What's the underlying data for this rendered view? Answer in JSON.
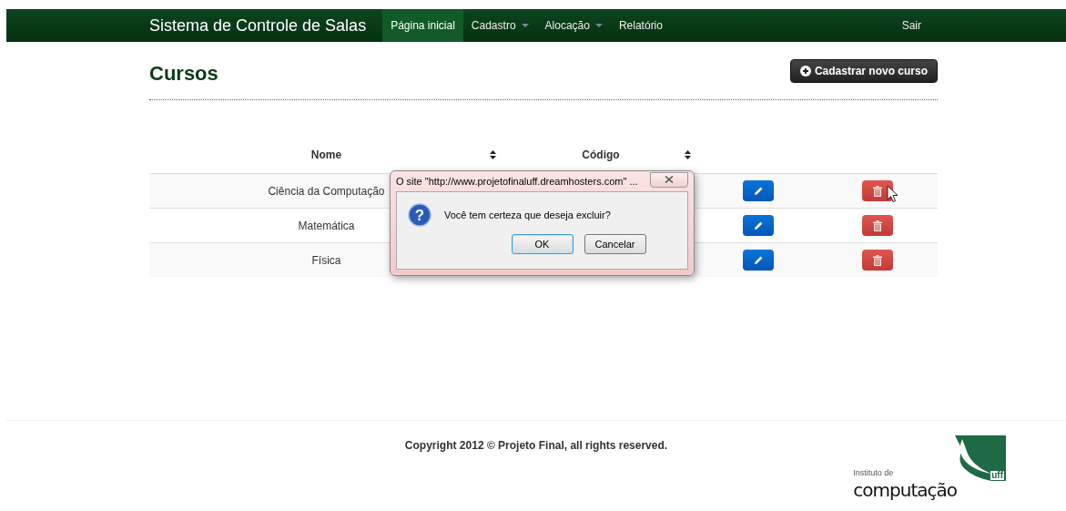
{
  "navbar": {
    "brand": "Sistema de Controle de Salas",
    "items": [
      {
        "label": "Página inicial",
        "selected": true,
        "dropdown": false
      },
      {
        "label": "Cadastro",
        "selected": false,
        "dropdown": true
      },
      {
        "label": "Alocação",
        "selected": false,
        "dropdown": true
      },
      {
        "label": "Relatório",
        "selected": false,
        "dropdown": false
      }
    ],
    "logout": "Sair"
  },
  "page": {
    "title": "Cursos",
    "add_button": "Cadastrar novo curso"
  },
  "table": {
    "columns": [
      {
        "label": "Nome",
        "sortable": true
      },
      {
        "label": "Código",
        "sortable": true
      }
    ],
    "rows": [
      {
        "name": "Ciência da Computação",
        "hovered": true
      },
      {
        "name": "Matemática",
        "hovered": false
      },
      {
        "name": "Física",
        "hovered": false
      }
    ]
  },
  "dialog": {
    "icon": "?",
    "title": "O site \"http://www.projetofinaluff.dreamhosters.com\" ...",
    "message": "Você tem certeza que deseja excluir?",
    "buttons": [
      {
        "label": "OK",
        "focused": true
      },
      {
        "label": "Cancelar",
        "focused": false
      }
    ]
  },
  "footer": {
    "copyright": "Copyright 2012 © Projeto Final, all rights reserved.",
    "logo": {
      "small": "Instituto de",
      "large": "computação",
      "mark": "uff"
    }
  }
}
